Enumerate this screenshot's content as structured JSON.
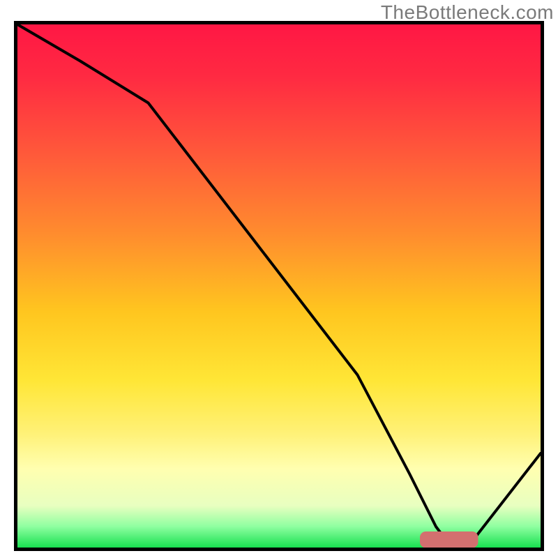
{
  "watermark": "TheBottleneck.com",
  "colors": {
    "gradient_stops": [
      {
        "offset": 0.0,
        "color": "#ff1744"
      },
      {
        "offset": 0.1,
        "color": "#ff2a42"
      },
      {
        "offset": 0.25,
        "color": "#ff5a3a"
      },
      {
        "offset": 0.4,
        "color": "#ff8c2e"
      },
      {
        "offset": 0.55,
        "color": "#ffc61f"
      },
      {
        "offset": 0.68,
        "color": "#ffe636"
      },
      {
        "offset": 0.78,
        "color": "#fff176"
      },
      {
        "offset": 0.85,
        "color": "#ffffb0"
      },
      {
        "offset": 0.92,
        "color": "#e8ffc0"
      },
      {
        "offset": 0.96,
        "color": "#8effa0"
      },
      {
        "offset": 1.0,
        "color": "#18e050"
      }
    ],
    "curve_stroke": "#000000",
    "marker_fill": "#d36f6f",
    "marker_stroke": "#d36f6f"
  },
  "chart_data": {
    "type": "line",
    "title": "",
    "xlabel": "",
    "ylabel": "",
    "xlim": [
      0,
      100
    ],
    "ylim": [
      0,
      100
    ],
    "grid": false,
    "legend": false,
    "series": [
      {
        "name": "bottleneck-curve",
        "x": [
          0,
          12,
          25,
          35,
          45,
          55,
          65,
          75,
          80,
          83,
          86,
          100
        ],
        "y": [
          100,
          93,
          85,
          72,
          59,
          46,
          33,
          14,
          4,
          0,
          0,
          18
        ]
      }
    ],
    "marker": {
      "name": "optimal-range",
      "shape": "rounded-bar",
      "x_start": 77,
      "x_end": 88,
      "y": 1.5,
      "height": 3
    }
  }
}
